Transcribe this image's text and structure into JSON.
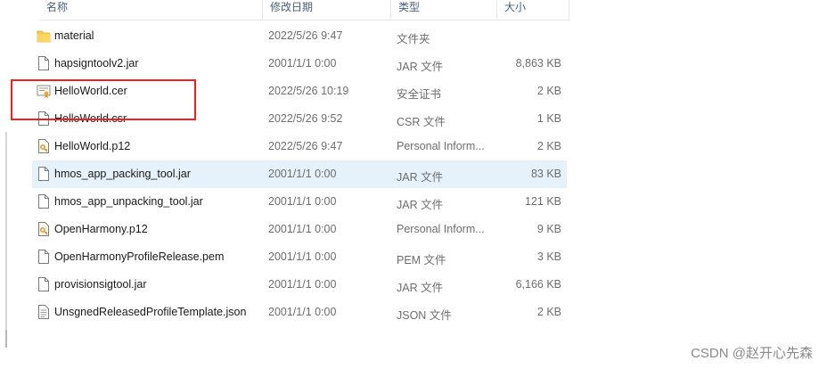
{
  "headers": {
    "name": "名称",
    "date": "修改日期",
    "type": "类型",
    "size": "大小"
  },
  "files": [
    {
      "name": "material",
      "date": "2022/5/26 9:47",
      "type": "文件夹",
      "size": "",
      "icon": "folder-icon"
    },
    {
      "name": "hapsigntoolv2.jar",
      "date": "2001/1/1 0:00",
      "type": "JAR 文件",
      "size": "8,863 KB",
      "icon": "file-icon"
    },
    {
      "name": "HelloWorld.cer",
      "date": "2022/5/26 10:19",
      "type": "安全证书",
      "size": "2 KB",
      "icon": "certificate-icon"
    },
    {
      "name": "HelloWorld.csr",
      "date": "2022/5/26 9:52",
      "type": "CSR 文件",
      "size": "1 KB",
      "icon": "file-icon"
    },
    {
      "name": "HelloWorld.p12",
      "date": "2022/5/26 9:47",
      "type": "Personal Inform...",
      "size": "2 KB",
      "icon": "p12-icon"
    },
    {
      "name": "hmos_app_packing_tool.jar",
      "date": "2001/1/1 0:00",
      "type": "JAR 文件",
      "size": "83 KB",
      "icon": "file-icon"
    },
    {
      "name": "hmos_app_unpacking_tool.jar",
      "date": "2001/1/1 0:00",
      "type": "JAR 文件",
      "size": "121 KB",
      "icon": "file-icon"
    },
    {
      "name": "OpenHarmony.p12",
      "date": "2001/1/1 0:00",
      "type": "Personal Inform...",
      "size": "9 KB",
      "icon": "p12-icon"
    },
    {
      "name": "OpenHarmonyProfileRelease.pem",
      "date": "2001/1/1 0:00",
      "type": "PEM 文件",
      "size": "3 KB",
      "icon": "file-icon"
    },
    {
      "name": "provisionsigtool.jar",
      "date": "2001/1/1 0:00",
      "type": "JAR 文件",
      "size": "6,166 KB",
      "icon": "file-icon"
    },
    {
      "name": "UnsgnedReleasedProfileTemplate.json",
      "date": "2001/1/1 0:00",
      "type": "JSON 文件",
      "size": "2 KB",
      "icon": "json-file-icon"
    }
  ],
  "watermark": "CSDN @赵开心先森",
  "colors": {
    "hover_row": "#e5f1fb",
    "highlight_border": "#ee2222",
    "folder": "#f8c94a"
  }
}
